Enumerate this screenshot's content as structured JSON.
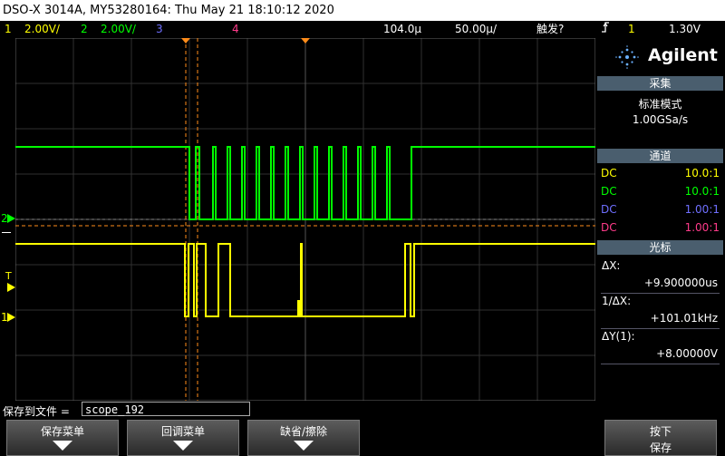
{
  "title": "DSO-X 3014A, MY53280164: Thu May 21 18:10:12 2020",
  "topbar": {
    "ch1_num": "1",
    "ch1_scale": "2.00V/",
    "ch2_num": "2",
    "ch2_scale": "2.00V/",
    "ch3_num": "3",
    "ch4_num": "4",
    "delay": "104.0µ",
    "timebase": "50.00µ/",
    "trigger_label": "触发?",
    "trig_src": "1",
    "trig_level": "1.30V"
  },
  "sidebar": {
    "brand": "Agilent",
    "acq_header": "采集",
    "acq_mode": "标准模式",
    "acq_rate": "1.00GSa/s",
    "chan_header": "通道",
    "channels": [
      {
        "coupling": "DC",
        "probe": "10.0:1",
        "color": "#ffff00"
      },
      {
        "coupling": "DC",
        "probe": "10.0:1",
        "color": "#00ff00"
      },
      {
        "coupling": "DC",
        "probe": "1.00:1",
        "color": "#6f6fff"
      },
      {
        "coupling": "DC",
        "probe": "1.00:1",
        "color": "#ff3b8a"
      }
    ],
    "cursor_header": "光标",
    "dx_label": "ΔX:",
    "dx_value": "+9.900000us",
    "inv_dx_label": "1/ΔX:",
    "inv_dx_value": "+101.01kHz",
    "dy_label": "ΔY(1):",
    "dy_value": "+8.00000V"
  },
  "markers": {
    "ch2": "2",
    "trigger": "T",
    "ch1": "1"
  },
  "file": {
    "label": "保存到文件 =",
    "value": "scope_192"
  },
  "softkeys": {
    "save_menu": "保存菜单",
    "recall_menu": "回调菜单",
    "default_erase": "缺省/擦除",
    "press_line1": "按下",
    "press_line2": "保存"
  },
  "colors": {
    "ch1": "#ffff00",
    "ch2": "#00ff00",
    "ch3": "#6f6fff",
    "ch4": "#ff3b8a",
    "cursor": "#ff8c1a",
    "header": "#4a5e6e"
  }
}
